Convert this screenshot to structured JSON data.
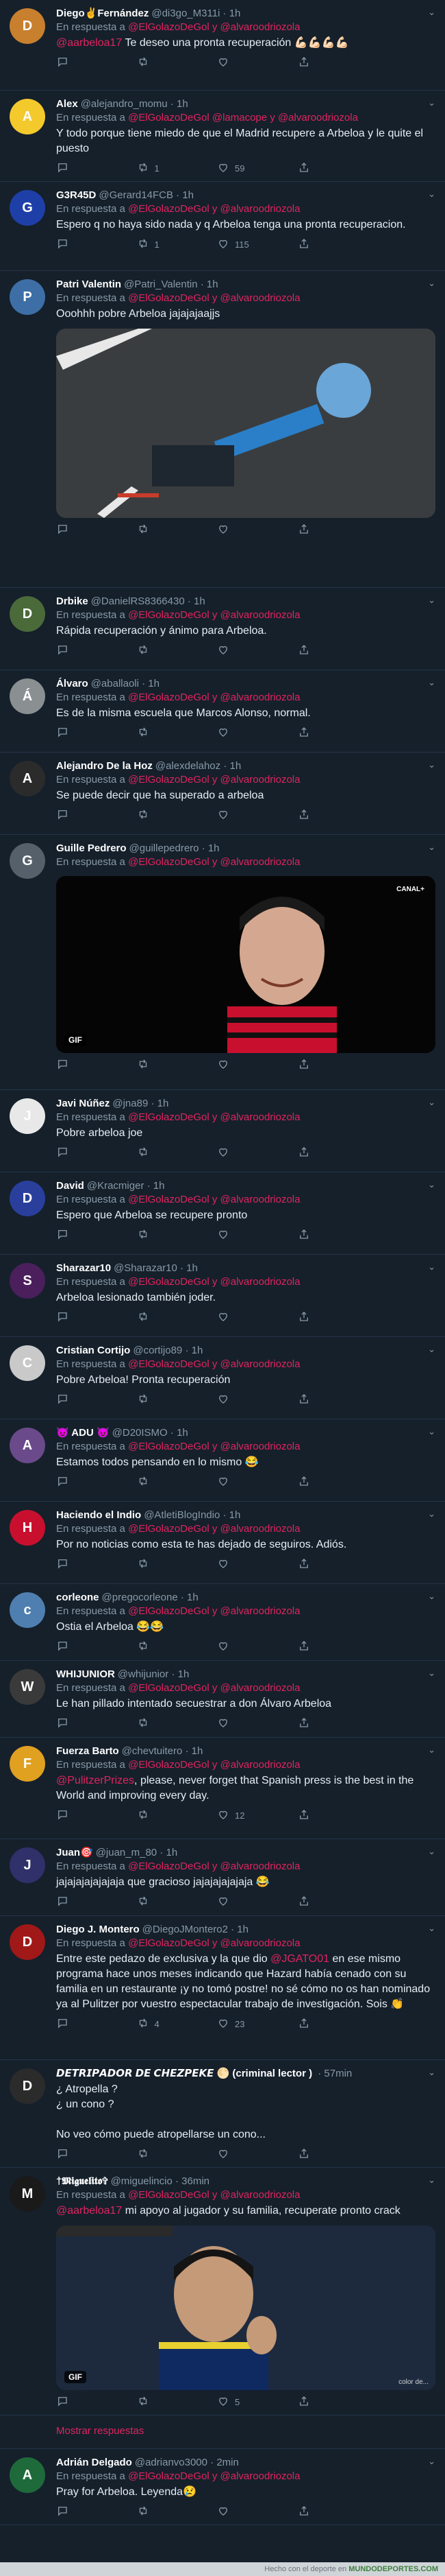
{
  "tweets": [
    {
      "name": "Diego✌️Fernández",
      "handle": "@di3go_M311i",
      "time": "· 1h",
      "reply": "En respuesta a",
      "mentions": "@ElGolazoDeGol y @alvaroodriozola",
      "text_mention": "@aarbeloa17",
      "text": " Te deseo una pronta recuperación 💪🏻💪🏻💪🏻💪🏻",
      "likes": "",
      "rts": "",
      "comments": "",
      "color": "#c87f2e",
      "ini": "D"
    },
    {
      "name": "Alex",
      "handle": "@alejandro_momu",
      "time": "· 1h",
      "reply": "En respuesta a",
      "mentions": "@ElGolazoDeGol @lamacope y @alvaroodriozola",
      "text": "Y todo porque tiene miedo de que el Madrid recupere a Arbeloa y le quite el puesto",
      "comments": "",
      "rts": "1",
      "likes": "59",
      "color": "#f4c92b",
      "ini": "A"
    },
    {
      "name": "G3R45D",
      "handle": "@Gerard14FCB",
      "time": "· 1h",
      "reply": "En respuesta a",
      "mentions": "@ElGolazoDeGol y @alvaroodriozola",
      "text": "Espero q no haya sido nada y q Arbeloa tenga una pronta recuperacion.",
      "comments": "",
      "rts": "1",
      "likes": "115",
      "color": "#1f3fa8",
      "ini": "G"
    },
    {
      "name": "Patri Valentin",
      "handle": "@Patri_Valentin",
      "time": "· 1h",
      "reply": "En respuesta a",
      "mentions": "@ElGolazoDeGol y @alvaroodriozola",
      "text": "Ooohhh pobre Arbeloa jajajajaajjs",
      "comments": "",
      "rts": "",
      "likes": "",
      "color": "#3d6fa6",
      "ini": "P",
      "media": "video"
    },
    {
      "name": "Drbike",
      "handle": "@DanielRS8366430",
      "time": "· 1h",
      "reply": "En respuesta a",
      "mentions": "@ElGolazoDeGol y @alvaroodriozola",
      "text": "Rápida recuperación y ánimo para Arbeloa.",
      "comments": "",
      "rts": "",
      "likes": "",
      "color": "#4a6a3a",
      "ini": "D"
    },
    {
      "name": "Álvaro",
      "handle": "@aballaoli",
      "time": "· 1h",
      "reply": "En respuesta a",
      "mentions": "@ElGolazoDeGol y @alvaroodriozola",
      "text": "Es de la misma escuela que Marcos Alonso, normal.",
      "comments": "",
      "rts": "",
      "likes": "",
      "color": "#8a8f92",
      "ini": "Á"
    },
    {
      "name": "Alejandro De la Hoz",
      "handle": "@alexdelahoz",
      "time": "· 1h",
      "reply": "En respuesta a",
      "mentions": "@ElGolazoDeGol y @alvaroodriozola",
      "text": "Se puede decir que ha superado a arbeloa",
      "comments": "",
      "rts": "",
      "likes": "",
      "color": "#2b2b2b",
      "ini": "A"
    },
    {
      "name": "Guille Pedrero",
      "handle": "@guillepedrero",
      "time": "· 1h",
      "reply": "En respuesta a",
      "mentions": "@ElGolazoDeGol y @alvaroodriozola",
      "text": "",
      "comments": "",
      "rts": "",
      "likes": "",
      "color": "#55606a",
      "ini": "G",
      "media": "face"
    },
    {
      "name": "Javi Núñez",
      "handle": "@jna89",
      "time": "· 1h",
      "reply": "En respuesta a",
      "mentions": "@ElGolazoDeGol y @alvaroodriozola",
      "text": "Pobre arbeloa joe",
      "comments": "",
      "rts": "",
      "likes": "",
      "color": "#e8e8e8",
      "ini": "J"
    },
    {
      "name": "David",
      "handle": "@Kracmiger",
      "time": "· 1h",
      "reply": "En respuesta a",
      "mentions": "@ElGolazoDeGol y @alvaroodriozola",
      "text": "Espero que Arbeloa se recupere pronto",
      "comments": "",
      "rts": "",
      "likes": "",
      "color": "#2a3f9c",
      "ini": "D"
    },
    {
      "name": "Sharazar10",
      "handle": "@Sharazar10",
      "time": "· 1h",
      "reply": "En respuesta a",
      "mentions": "@ElGolazoDeGol y @alvaroodriozola",
      "text": "Arbeloa lesionado también joder.",
      "comments": "",
      "rts": "",
      "likes": "",
      "color": "#4a1f5c",
      "ini": "S"
    },
    {
      "name": "Cristian Cortijo",
      "handle": "@cortijo89",
      "time": "· 1h",
      "reply": "En respuesta a",
      "mentions": "@ElGolazoDeGol y @alvaroodriozola",
      "text": "Pobre Arbeloa! Pronta recuperación",
      "comments": "",
      "rts": "",
      "likes": "",
      "color": "#c9c9c9",
      "ini": "C"
    },
    {
      "name": "😈 ADU 😈",
      "handle": "@D20ISMO",
      "time": "· 1h",
      "reply": "En respuesta a",
      "mentions": "@ElGolazoDeGol y @alvaroodriozola",
      "text": "Estamos todos pensando en lo mismo 😂",
      "comments": "",
      "rts": "",
      "likes": "",
      "color": "#6a4a8a",
      "ini": "A"
    },
    {
      "name": "Haciendo el Indio",
      "handle": "@AtletiBlogIndio",
      "time": "· 1h",
      "reply": "En respuesta a",
      "mentions": "@ElGolazoDeGol y @alvaroodriozola",
      "text": "Por no noticias como esta te has dejado de seguiros. Adiós.",
      "comments": "",
      "rts": "",
      "likes": "",
      "color": "#c8102e",
      "ini": "H"
    },
    {
      "name": "corleone",
      "handle": "@pregocorleone",
      "time": "· 1h",
      "reply": "En respuesta a",
      "mentions": "@ElGolazoDeGol y @alvaroodriozola",
      "text": "Ostia el Arbeloa 😂😂",
      "comments": "",
      "rts": "",
      "likes": "",
      "color": "#4f7fb0",
      "ini": "c"
    },
    {
      "name": "WHIJUNIOR",
      "handle": "@whijunior",
      "time": "· 1h",
      "reply": "En respuesta a",
      "mentions": "@ElGolazoDeGol y @alvaroodriozola",
      "text": "Le han pillado intentado secuestrar a don Álvaro Arbeloa",
      "comments": "",
      "rts": "",
      "likes": "",
      "color": "#3a3a3a",
      "ini": "W"
    },
    {
      "name": "Fuerza Barto",
      "handle": "@chevtuitero",
      "time": "· 1h",
      "reply": "En respuesta a",
      "mentions": "@ElGolazoDeGol y @alvaroodriozola",
      "text_mention": "@PulitzerPrizes",
      "text": ", please, never forget that Spanish press is the best in the World and improving every day.",
      "comments": "",
      "rts": "",
      "likes": "12",
      "color": "#e0a020",
      "ini": "F"
    },
    {
      "name": "Juan🎯",
      "handle": "@juan_m_80",
      "time": "· 1h",
      "reply": "En respuesta a",
      "mentions": "@ElGolazoDeGol y @alvaroodriozola",
      "text": "jajajajajajajaja que gracioso jajajajajajaja 😂",
      "comments": "",
      "rts": "",
      "likes": "",
      "color": "#30306a",
      "ini": "J"
    },
    {
      "name": "Diego J. Montero",
      "handle": "@DiegoJMontero2",
      "time": "· 1h",
      "reply": "En respuesta a",
      "mentions": "@ElGolazoDeGol y @alvaroodriozola",
      "text_pre": "Entre este pedazo de exclusiva y la que dio ",
      "text_mention": "@JGATO01",
      "text": " en ese mismo programa hace unos meses indicando que Hazard había cenado con su familia en un restaurante ¡y no tomó postre! no sé cómo no os han nominado ya al Pulitzer por vuestro espectacular trabajo de investigación. Sois 👏",
      "comments": "",
      "rts": "4",
      "likes": "23",
      "color": "#a01818",
      "ini": "D"
    },
    {
      "name": "𝘿𝙀𝙏𝙍𝙄𝙋𝘼𝘿𝙊𝙍 𝘿𝙀 𝘾𝙃𝙀𝙕𝙋𝙀𝙆𝙀 🌕 (criminal lector )",
      "handle": "",
      "time": "· 57min",
      "reply": "",
      "mentions": "",
      "text": "¿ Atropella ?\n¿ un cono ?\n\nNo veo cómo puede atropellarse un cono...",
      "comments": "",
      "rts": "",
      "likes": "",
      "color": "#2b2b2b",
      "ini": "D"
    },
    {
      "name": "†𝕸𝖎𝖌𝖚𝖊𝖑𝖎𝖙𝖔✞",
      "handle": "@miguelincio",
      "time": "· 36min",
      "reply": "En respuesta a",
      "mentions": "@ElGolazoDeGol y @alvaroodriozola",
      "text_mention": "@aarbeloa17",
      "text": " mi apoyo al jugador y su familia, recuperate pronto crack",
      "comments": "",
      "rts": "",
      "likes": "5",
      "color": "#1a1a1a",
      "ini": "M",
      "media": "thumb"
    },
    {
      "name": "Adrián Delgado",
      "handle": "@adrianvo3000",
      "time": "· 2min",
      "reply": "En respuesta a",
      "mentions": "@ElGolazoDeGol y @alvaroodriozola",
      "text": "Pray for Arbeloa. Leyenda😢",
      "comments": "",
      "rts": "",
      "likes": "",
      "color": "#1f6a3a",
      "ini": "A"
    }
  ],
  "show_more": "Mostrar respuestas",
  "gif_label": "GIF",
  "canal": "CANAL+",
  "footer": "Hecho con el deporte en",
  "footer_brand": "MUNDODEPORTES.COM",
  "watermark": "color de..."
}
